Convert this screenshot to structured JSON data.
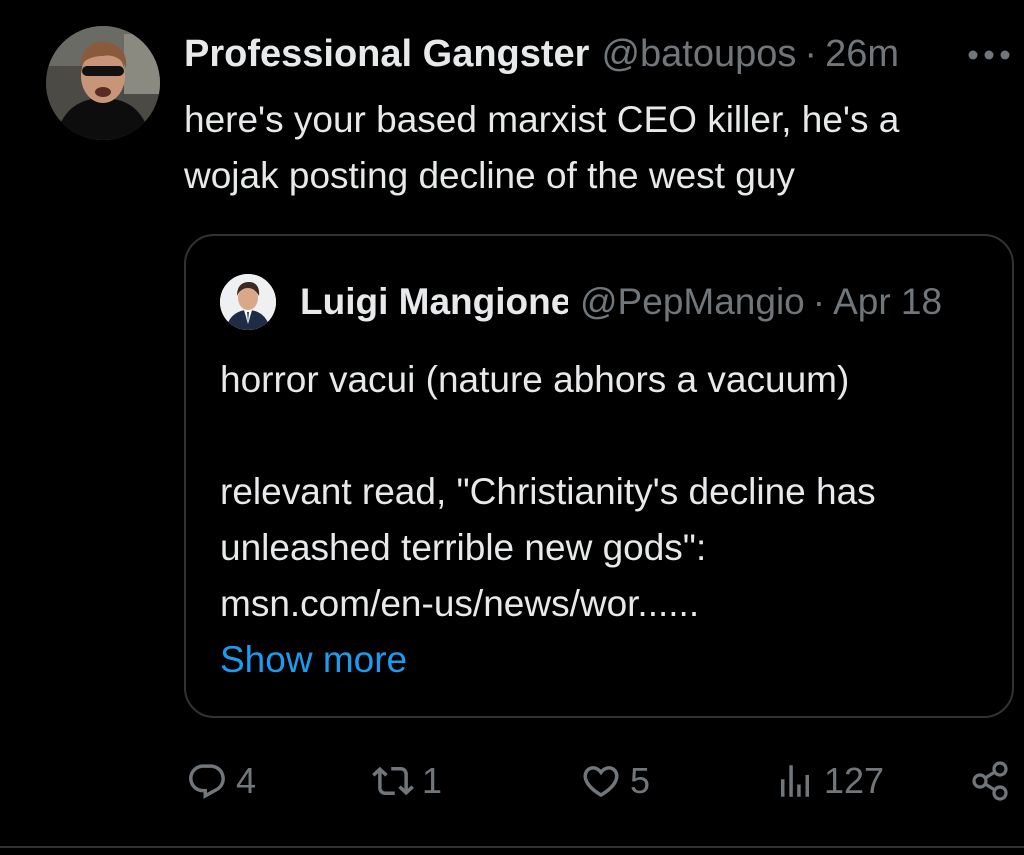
{
  "tweet": {
    "author_name": "Professional Gangster",
    "author_handle": "@batoupos",
    "separator": "·",
    "time": "26m",
    "text": "here's your based marxist CEO killer, he's a\nwojak posting decline of the west guy",
    "avatar_icon": "profile-photo-man-sunglasses"
  },
  "quote": {
    "author_name": "Luigi Mangione",
    "author_handle": "@PepMangio",
    "separator": "·",
    "time": "Apr 18",
    "lines": [
      "horror vacui (nature abhors a vacuum)",
      "",
      "relevant read, \"Christianity's decline has",
      "unleashed terrible new gods\":",
      "msn.com/en-us/news/wor......"
    ],
    "show_more": "Show more",
    "avatar_icon": "profile-photo-man-suit"
  },
  "actions": {
    "replies": "4",
    "reposts": "1",
    "likes": "5",
    "views": "127"
  },
  "icons": {
    "more": "more-horizontal-icon",
    "reply": "reply-icon",
    "repost": "repost-icon",
    "like": "heart-icon",
    "views": "views-icon",
    "share": "share-icon"
  },
  "colors": {
    "background": "#000000",
    "text": "#e7e9ea",
    "muted": "#71767b",
    "link": "#1d9bf0",
    "border": "#2f3336"
  }
}
